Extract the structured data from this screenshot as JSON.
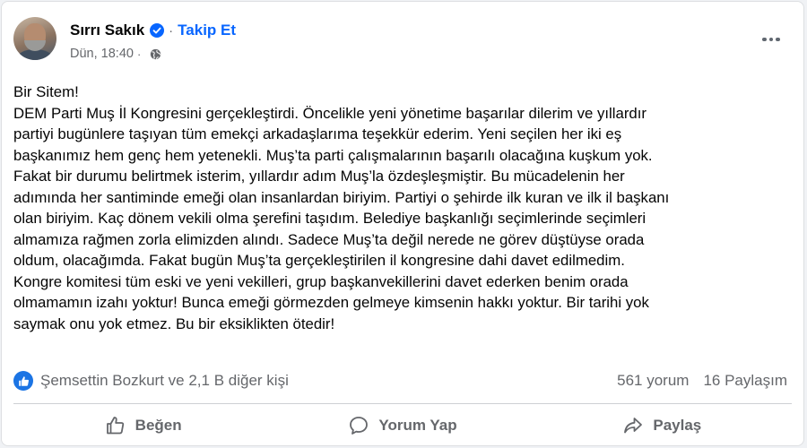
{
  "post": {
    "author": "Sırrı Sakık",
    "follow_label": "Takip Et",
    "separator": "·",
    "timestamp": "Dün, 18:40",
    "timestamp_separator": "·",
    "lines": [
      "Bir Sitem!",
      "DEM Parti Muş İl Kongresini gerçekleştirdi. Öncelikle yeni yönetime başarılar dilerim ve yıllardır",
      "partiyi bugünlere taşıyan tüm emekçi arkadaşlarıma teşekkür ederim. Yeni seçilen her iki eş",
      "başkanımız  hem genç hem yetenekli. Muş’ta parti çalışmalarının başarılı olacağına kuşkum yok.",
      "Fakat bir durumu belirtmek isterim,  yıllardır adım Muş’la özdeşleşmiştir. Bu mücadelenin her",
      "adımında her santiminde emeği olan insanlardan biriyim. Partiyi o şehirde ilk kuran ve ilk il başkanı",
      "olan biriyim. Kaç dönem vekili olma şerefini taşıdım. Belediye başkanlığı seçimlerinde seçimleri",
      "almamıza rağmen zorla elimizden alındı. Sadece Muş’ta değil nerede ne görev düştüyse orada",
      "oldum, olacağımda. Fakat bugün Muş’ta gerçekleştirilen il kongresine dahi davet edilmedim.",
      "Kongre komitesi tüm eski ve yeni vekilleri, grup başkanvekillerini davet ederken benim orada",
      "olmamamın izahı yoktur! Bunca emeği görmezden gelmeye kimsenin hakkı yoktur. Bir tarihi yok",
      "saymak onu yok etmez. Bu bir eksiklikten ötedir!"
    ]
  },
  "engagement": {
    "reactors": "Şemsettin Bozkurt ve 2,1 B diğer kişi",
    "comments": "561 yorum",
    "shares": "16 Paylaşım"
  },
  "actions": {
    "like": "Beğen",
    "comment": "Yorum Yap",
    "share": "Paylaş"
  },
  "colors": {
    "accent": "#0866ff",
    "like_badge": "#1b74e4",
    "secondary_text": "#65676b"
  },
  "icons": {
    "verified": "verified-badge-icon",
    "privacy": "globe-icon",
    "more": "more-dots-icon",
    "like_badge": "thumbs-up-icon",
    "like_action": "thumbs-up-outline-icon",
    "comment_action": "speech-bubble-icon",
    "share_action": "share-arrow-icon"
  }
}
